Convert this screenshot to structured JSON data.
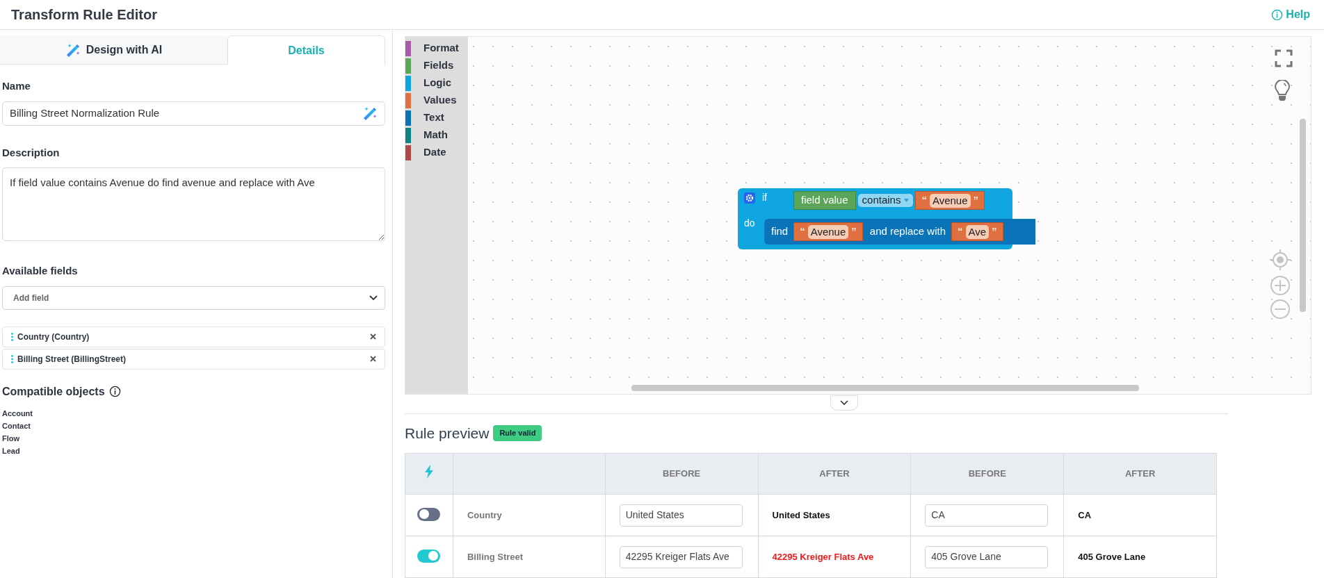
{
  "header": {
    "title": "Transform Rule Editor",
    "help": "Help"
  },
  "tabs": [
    {
      "label": "Design with AI",
      "selected": false,
      "kind": "ai"
    },
    {
      "label": "Details",
      "selected": true,
      "kind": "plain"
    }
  ],
  "form": {
    "name": {
      "label": "Name",
      "value": "Billing Street Normalization Rule"
    },
    "description": {
      "label": "Description",
      "value": "If field value contains Avenue do find avenue and replace with Ave"
    },
    "available_fields": {
      "label": "Available fields",
      "placeholder": "Add field",
      "fields": [
        {
          "label": "Country (Country)"
        },
        {
          "label": "Billing Street (BillingStreet)"
        }
      ]
    },
    "compatible_objects": {
      "label": "Compatible objects",
      "items": [
        "Account",
        "Contact",
        "Flow",
        "Lead"
      ]
    }
  },
  "toolbox": [
    {
      "label": "Format",
      "color": "#a55ba5"
    },
    {
      "label": "Fields",
      "color": "#5ba55b"
    },
    {
      "label": "Logic",
      "color": "#0ea5e0"
    },
    {
      "label": "Values",
      "color": "#e0703f"
    },
    {
      "label": "Text",
      "color": "#0b74b8"
    },
    {
      "label": "Math",
      "color": "#0d8585"
    },
    {
      "label": "Date",
      "color": "#b04848"
    }
  ],
  "blocks": {
    "if_label": "if",
    "do_label": "do",
    "condition": {
      "field": "field value",
      "operator": "contains",
      "value": {
        "open": "“",
        "text": "Avenue",
        "close": "”"
      }
    },
    "action": {
      "label": "find",
      "find": {
        "open": "“",
        "text": "Avenue",
        "close": "”"
      },
      "joiner": "and replace with",
      "replace": {
        "open": "“",
        "text": "Ave",
        "close": "”"
      }
    }
  },
  "preview": {
    "title": "Rule preview",
    "badge": "Rule valid",
    "columns": [
      "BEFORE",
      "AFTER",
      "BEFORE",
      "AFTER"
    ],
    "rows": [
      {
        "field": "Country",
        "on": false,
        "samples": [
          {
            "before": "United States",
            "after": "United States",
            "changed": false
          },
          {
            "before": "CA",
            "after": "CA",
            "changed": false
          }
        ]
      },
      {
        "field": "Billing Street",
        "on": true,
        "samples": [
          {
            "before": "42295 Kreiger Flats Ave",
            "after": "42295 Kreiger Flats Ave",
            "changed": true
          },
          {
            "before": "405 Grove Lane",
            "after": "405 Grove Lane",
            "changed": false
          }
        ]
      }
    ]
  }
}
